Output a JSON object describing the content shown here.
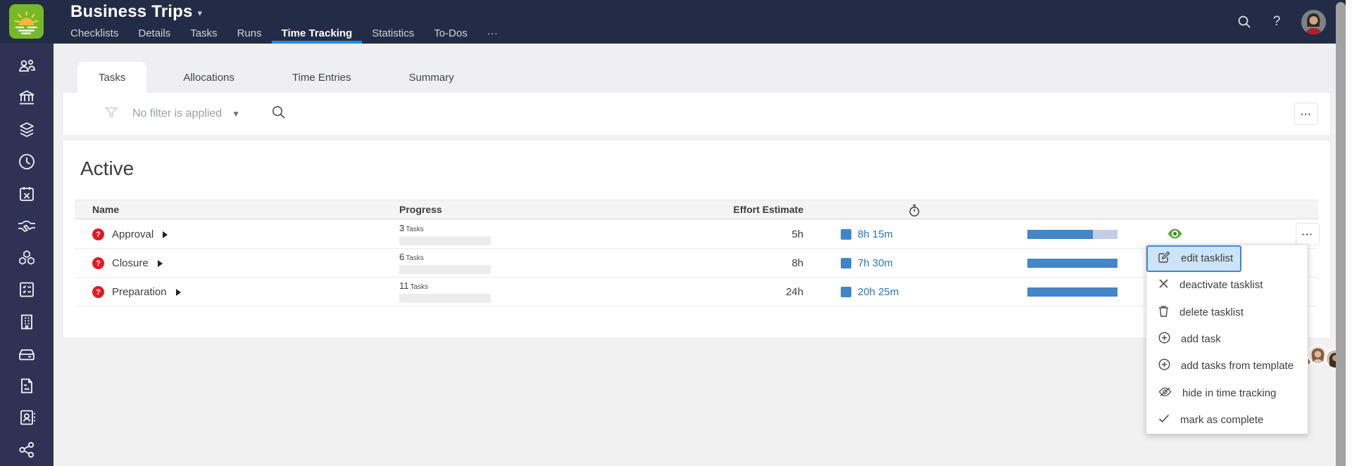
{
  "header": {
    "project_title": "Business Trips",
    "title_caret": "▾",
    "tabs": [
      {
        "label": "Checklists",
        "active": false
      },
      {
        "label": "Details",
        "active": false
      },
      {
        "label": "Tasks",
        "active": false
      },
      {
        "label": "Runs",
        "active": false
      },
      {
        "label": "Time Tracking",
        "active": true
      },
      {
        "label": "Statistics",
        "active": false
      },
      {
        "label": "To-Dos",
        "active": false
      },
      {
        "label": "···",
        "active": false
      }
    ],
    "help_glyph": "?",
    "icons": [
      "sunrise-logo",
      "search-icon",
      "help-icon",
      "user-avatar"
    ]
  },
  "sidebar": {
    "items": [
      "people-group-icon",
      "bank-icon",
      "layers-icon",
      "clock-icon",
      "calendar-x-icon",
      "handshake-icon",
      "cubes-icon",
      "checklist-board-icon",
      "building-icon",
      "drive-tray-icon",
      "document-image-icon",
      "contact-card-icon",
      "share-network-icon"
    ]
  },
  "subtabs": [
    {
      "label": "Tasks",
      "active": true
    },
    {
      "label": "Allocations",
      "active": false
    },
    {
      "label": "Time Entries",
      "active": false
    },
    {
      "label": "Summary",
      "active": false
    }
  ],
  "filter": {
    "label": "No filter is applied",
    "caret": "▼",
    "more_label": "···"
  },
  "section": {
    "title": "Active"
  },
  "table": {
    "columns": {
      "name": "Name",
      "progress": "Progress",
      "effort": "Effort Estimate",
      "timer": "stopwatch-icon"
    },
    "tasks_word": "Tasks",
    "badge_glyph": "?",
    "rows": [
      {
        "name": "Approval",
        "tasks_count": "3",
        "effort": "5h",
        "tracked": "8h 15m",
        "tracked_fill_pct": 73,
        "overrun": true,
        "progress_pct": 0
      },
      {
        "name": "Closure",
        "tasks_count": "6",
        "effort": "8h",
        "tracked": "7h 30m",
        "tracked_fill_pct": 100,
        "overrun": false,
        "progress_pct": 0
      },
      {
        "name": "Preparation",
        "tasks_count": "11",
        "effort": "24h",
        "tracked": "20h 25m",
        "tracked_fill_pct": 100,
        "overrun": false,
        "progress_pct": 0
      }
    ],
    "row_more_label": "···"
  },
  "context_menu": {
    "items": [
      {
        "label": "edit tasklist",
        "icon": "edit-icon",
        "highlighted": true
      },
      {
        "label": "deactivate tasklist",
        "icon": "x-icon",
        "highlighted": false
      },
      {
        "label": "delete tasklist",
        "icon": "trash-icon",
        "highlighted": false
      },
      {
        "label": "add task",
        "icon": "plus-circle-icon",
        "highlighted": false
      },
      {
        "label": "add tasks from template",
        "icon": "plus-circle-icon",
        "highlighted": false
      },
      {
        "label": "hide in time tracking",
        "icon": "eye-slash-icon",
        "highlighted": false
      },
      {
        "label": "mark as complete",
        "icon": "check-icon",
        "highlighted": false
      }
    ]
  },
  "colors": {
    "header_bg": "#232c46",
    "sidebar_bg": "#2e3355",
    "accent_blue": "#1d8ce9",
    "logo_green": "#76b82a",
    "badge_red": "#e11b24",
    "time_blue": "#2f74b5",
    "bar_blue": "#4486c7",
    "bar_overrun_light": "#c3cde6",
    "eye_green": "#56a73e",
    "menu_highlight_bg": "#cde4f6",
    "menu_highlight_border": "#3c86d1"
  }
}
